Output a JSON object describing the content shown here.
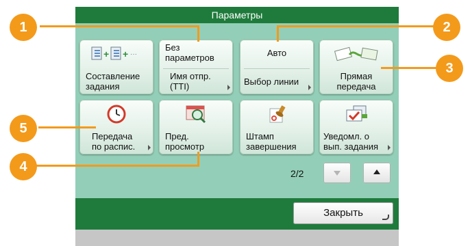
{
  "title": "Параметры",
  "buttons": {
    "compose_job": {
      "label": "Составление\nзадания",
      "icon": "document-merge-icon"
    },
    "sender_name": {
      "value": "Без\nпараметров",
      "label": "Имя отпр.\n(TTI)"
    },
    "line_select": {
      "value": "Авто",
      "label": "Выбор линии"
    },
    "direct_send": {
      "label": "Прямая\nпередача",
      "icon": "direct-send-icon"
    },
    "delayed_send": {
      "label": "Передача\nпо распис.",
      "icon": "clock-icon"
    },
    "preview": {
      "label": "Пред.\nпросмотр",
      "icon": "preview-magnifier-icon"
    },
    "done_stamp": {
      "label": "Штамп\nзавершения",
      "icon": "stamp-icon"
    },
    "job_notify": {
      "label": "Уведомл. о\nвып. задания",
      "icon": "job-notification-icon"
    }
  },
  "pager": {
    "page": "2/2"
  },
  "close_label": "Закрыть",
  "callouts": [
    "1",
    "2",
    "3",
    "4",
    "5"
  ],
  "colors": {
    "accent": "#f39a1b",
    "bar": "#1f7b3c",
    "panel": "#93cfb8"
  }
}
